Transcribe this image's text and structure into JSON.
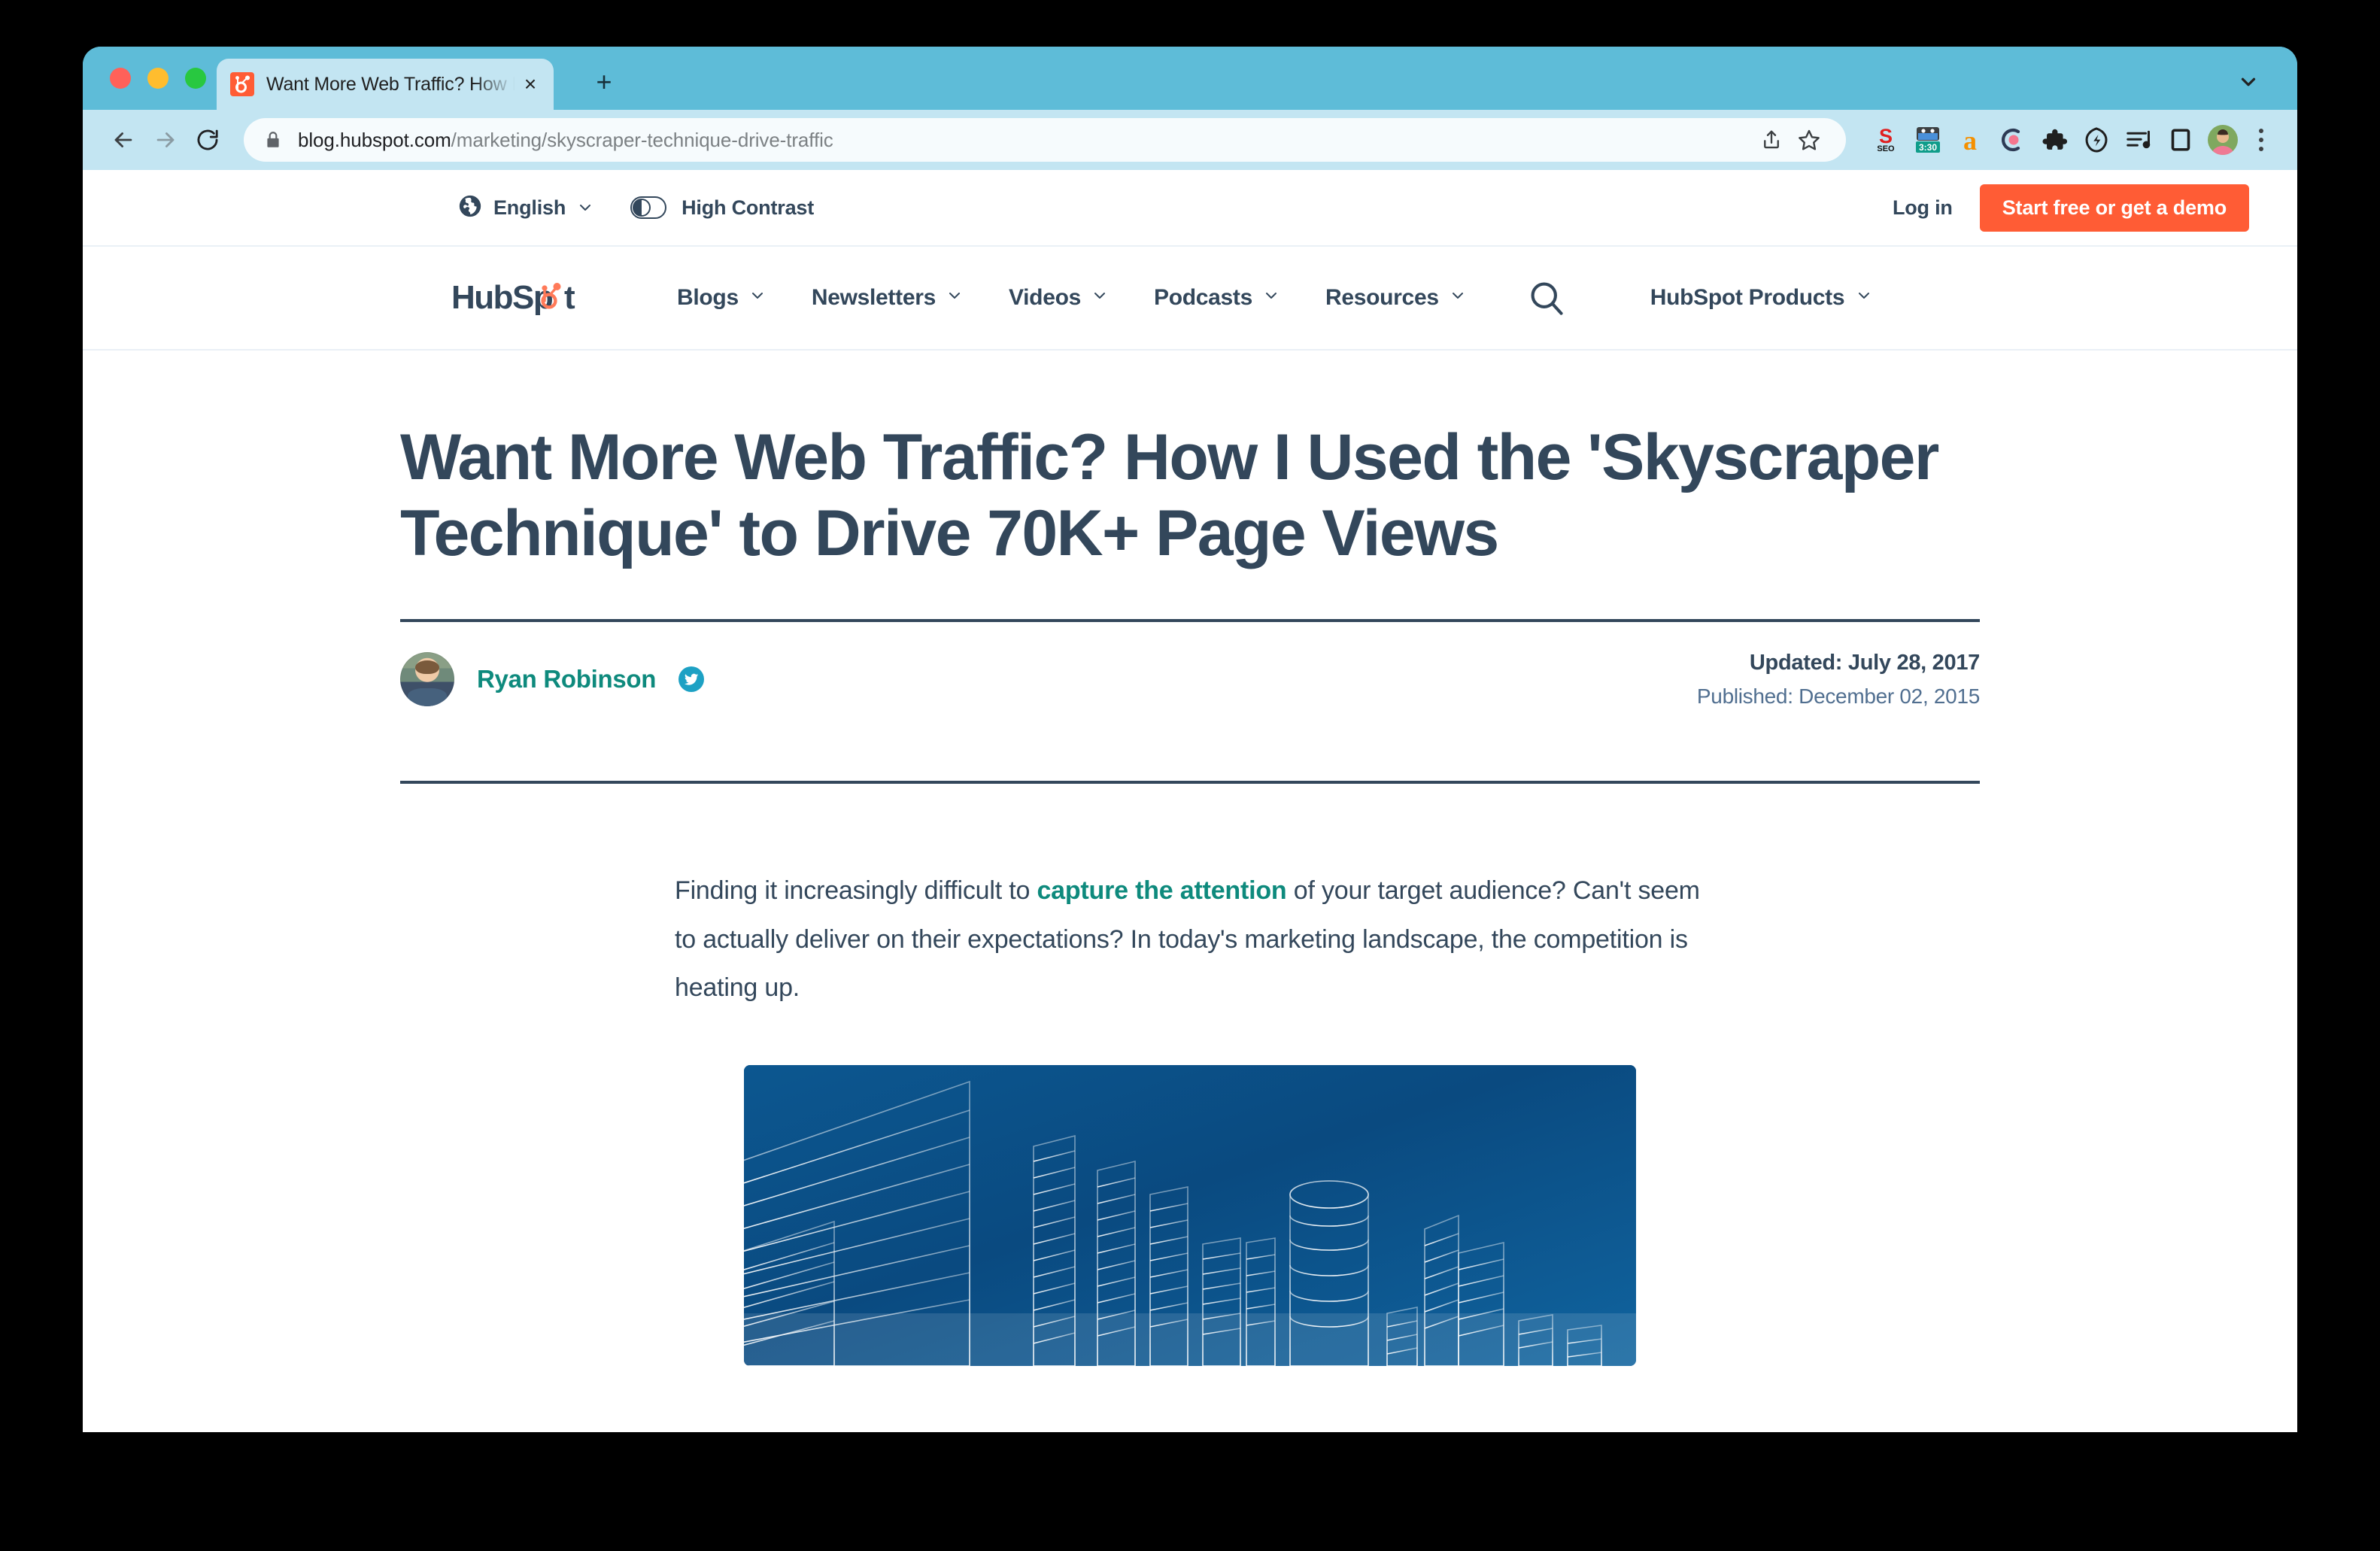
{
  "browser": {
    "tab": {
      "title": "Want More Web Traffic? How I",
      "favicon": "hubspot-sprocket-favicon",
      "close_label": "×"
    },
    "new_tab_label": "+",
    "toolbar": {
      "back_icon": "back-arrow-icon",
      "forward_icon": "forward-arrow-icon",
      "reload_icon": "reload-icon",
      "lock_icon": "lock-icon",
      "url_domain": "blog.hubspot.com",
      "url_path": "/marketing/skyscraper-technique-drive-traffic",
      "share_icon": "share-icon",
      "bookmark_icon": "star-icon",
      "extensions": [
        "seo-extension-icon",
        "screen-recorder-timer-icon",
        "amazon-assistant-icon",
        "c-circle-extension-icon",
        "puzzle-extensions-icon",
        "leaf-bolt-extension-icon",
        "music-playlist-icon",
        "reading-pane-icon"
      ],
      "recorder_badge": "3:30",
      "profile_avatar": "profile-avatar",
      "menu_icon": "three-dot-menu-icon"
    },
    "tabstrip_chevron": "chevron-down-icon"
  },
  "site": {
    "utility_bar": {
      "globe_icon": "globe-icon",
      "language": "English",
      "language_chevron": "chevron-down-icon",
      "contrast_toggle": "high-contrast-toggle",
      "contrast_label": "High Contrast",
      "login": "Log in",
      "cta": "Start free or get a demo"
    },
    "nav": {
      "logo": "HubSpot",
      "items": [
        {
          "label": "Blogs",
          "chevron": "chevron-down-icon"
        },
        {
          "label": "Newsletters",
          "chevron": "chevron-down-icon"
        },
        {
          "label": "Videos",
          "chevron": "chevron-down-icon"
        },
        {
          "label": "Podcasts",
          "chevron": "chevron-down-icon"
        },
        {
          "label": "Resources",
          "chevron": "chevron-down-icon"
        }
      ],
      "search_icon": "search-icon",
      "products": "HubSpot Products",
      "products_chevron": "chevron-down-icon"
    },
    "article": {
      "headline": "Want More Web Traffic? How I Used the 'Skyscraper Technique' to Drive 70K+ Page Views",
      "author": {
        "name": "Ryan Robinson",
        "avatar": "author-avatar",
        "twitter_icon": "twitter-icon"
      },
      "updated": "Updated: July 28, 2017",
      "published": "Published: December 02, 2015",
      "paragraph": {
        "before_link": "Finding it increasingly difficult to ",
        "link": "capture the attention",
        "after_link": " of your target audience? Can't seem to actually deliver on their expectations? In today's marketing landscape, the competition is heating up."
      },
      "hero_image": "wireframe-skyscrapers-illustration"
    }
  },
  "colors": {
    "window_chrome": "#5ebcd8",
    "toolbar": "#c3e5f2",
    "brand_orange": "#ff5c35",
    "brand_navy": "#33475b",
    "brand_teal": "#0e8a7d",
    "hero_blue": "#0b4d84"
  }
}
